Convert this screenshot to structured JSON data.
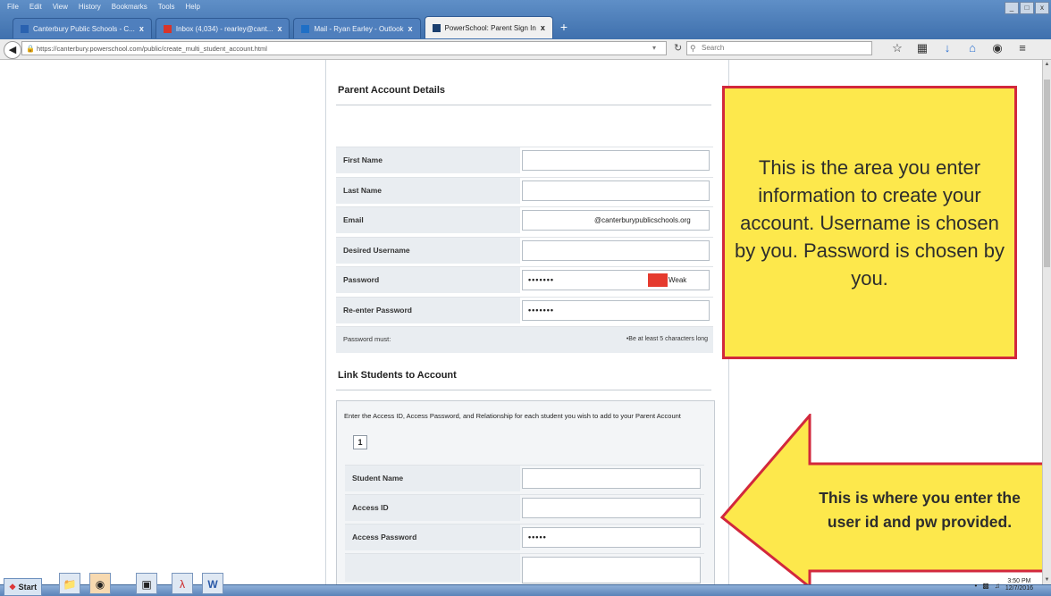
{
  "browser": {
    "menu": [
      "File",
      "Edit",
      "View",
      "History",
      "Bookmarks",
      "Tools",
      "Help"
    ],
    "window_controls": [
      "_",
      "□",
      "x"
    ],
    "tabs": [
      {
        "label": "Canterbury Public Schools - C...",
        "icon": "canterbury-favicon",
        "active": false
      },
      {
        "label": "Inbox (4,034) - rearley@cant...",
        "icon": "gmail-favicon",
        "active": false
      },
      {
        "label": "Mail - Ryan Earley - Outlook",
        "icon": "outlook-favicon",
        "active": false
      },
      {
        "label": "PowerSchool: Parent Sign In",
        "icon": "powerschool-favicon",
        "active": true
      }
    ],
    "url": "https://canterbury.powerschool.com/public/create_multi_student_account.html",
    "search_placeholder": "Search"
  },
  "form": {
    "parent_section_title": "Parent Account Details",
    "fields": [
      {
        "label": "First Name",
        "value": ""
      },
      {
        "label": "Last Name",
        "value": ""
      },
      {
        "label": "Email",
        "value": "@canterburypublicschools.org"
      },
      {
        "label": "Desired Username",
        "value": ""
      },
      {
        "label": "Password",
        "value": "•••••••",
        "strength": "Weak"
      },
      {
        "label": "Re-enter Password",
        "value": "•••••••"
      }
    ],
    "password_note_label": "Password must:",
    "password_note_rule": "•Be at least 5 characters long",
    "link_section_title": "Link Students to Account",
    "link_instructions": "Enter the Access ID, Access Password, and Relationship for each student you wish to add to your Parent Account",
    "student_number": "1",
    "student_fields": [
      {
        "label": "Student Name",
        "value": ""
      },
      {
        "label": "Access ID",
        "value": ""
      },
      {
        "label": "Access Password",
        "value": "•••••"
      }
    ]
  },
  "callouts": {
    "box_text": "This is the area you enter information to create your account. Username is chosen by you. Password is chosen by you.",
    "arrow_line1": "This is where you enter the",
    "arrow_line2": "user id and pw provided."
  },
  "taskbar": {
    "start_label": "Start",
    "time": "3:50 PM",
    "date": "12/7/2016"
  },
  "colors": {
    "callout_fill": "#fde84c",
    "callout_border": "#d2283c",
    "password_weak": "#e53a2e"
  }
}
